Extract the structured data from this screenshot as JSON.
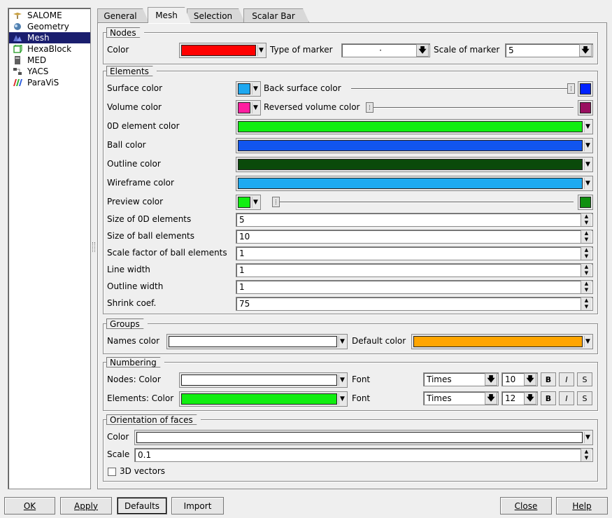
{
  "modules": [
    {
      "label": "SALOME",
      "icon": "salome-icon"
    },
    {
      "label": "Geometry",
      "icon": "geometry-icon"
    },
    {
      "label": "Mesh",
      "icon": "mesh-icon",
      "selected": true
    },
    {
      "label": "HexaBlock",
      "icon": "hexablock-icon"
    },
    {
      "label": "MED",
      "icon": "med-icon"
    },
    {
      "label": "YACS",
      "icon": "yacs-icon"
    },
    {
      "label": "ParaViS",
      "icon": "paravis-icon"
    }
  ],
  "tabs": {
    "general": "General",
    "mesh": "Mesh",
    "selection": "Selection",
    "scalar_bar": "Scalar Bar",
    "active": "Mesh"
  },
  "nodes": {
    "title": "Nodes",
    "color_label": "Color",
    "color": "#ff0000",
    "marker_label": "Type of marker",
    "marker_value": "·",
    "scale_label": "Scale of marker",
    "scale_value": "5"
  },
  "elements": {
    "title": "Elements",
    "surface_label": "Surface color",
    "surface_color": "#1ea8f0",
    "back_surface_label": "Back surface color",
    "back_surface_color": "#0022ff",
    "back_surface_slider": 1.0,
    "volume_label": "Volume color",
    "volume_color": "#ff1ea0",
    "reversed_volume_label": "Reversed volume color",
    "reversed_volume_color": "#991060",
    "reversed_volume_slider": 0.0,
    "el0d_label": "0D element color",
    "el0d_color": "#11ee11",
    "ball_label": "Ball color",
    "ball_color": "#1155ee",
    "outline_label": "Outline color",
    "outline_color": "#0a4a0a",
    "wireframe_label": "Wireframe color",
    "wireframe_color": "#1eaaf0",
    "preview_label": "Preview color",
    "preview_color": "#11ee11",
    "preview_color2": "#109010",
    "preview_slider": 0.0,
    "size0d_label": "Size of 0D elements",
    "size0d_value": "5",
    "size_ball_label": "Size of ball elements",
    "size_ball_value": "10",
    "scale_ball_label": "Scale factor of ball elements",
    "scale_ball_value": "1",
    "line_width_label": "Line width",
    "line_width_value": "1",
    "outline_width_label": "Outline width",
    "outline_width_value": "1",
    "shrink_label": "Shrink coef.",
    "shrink_value": "75"
  },
  "groups": {
    "title": "Groups",
    "names_label": "Names color",
    "names_color": "#ffffff",
    "default_label": "Default color",
    "default_color": "#ffa500"
  },
  "numbering": {
    "title": "Numbering",
    "nodes_label": "Nodes: Color",
    "nodes_color": "#ffffff",
    "nodes_font_label": "Font",
    "nodes_font": "Times",
    "nodes_size": "10",
    "elements_label": "Elements: Color",
    "elements_color": "#11ee11",
    "elements_font_label": "Font",
    "elements_font": "Times",
    "elements_size": "12",
    "bold": "B",
    "italic": "I",
    "shadow": "S"
  },
  "orientation": {
    "title": "Orientation of faces",
    "color_label": "Color",
    "color": "#ffffff",
    "scale_label": "Scale",
    "scale_value": "0.1",
    "vectors_label": "3D vectors",
    "vectors_checked": false
  },
  "buttons": {
    "ok": "OK",
    "apply": "Apply",
    "defaults": "Defaults",
    "import": "Import",
    "close": "Close",
    "help": "Help"
  }
}
